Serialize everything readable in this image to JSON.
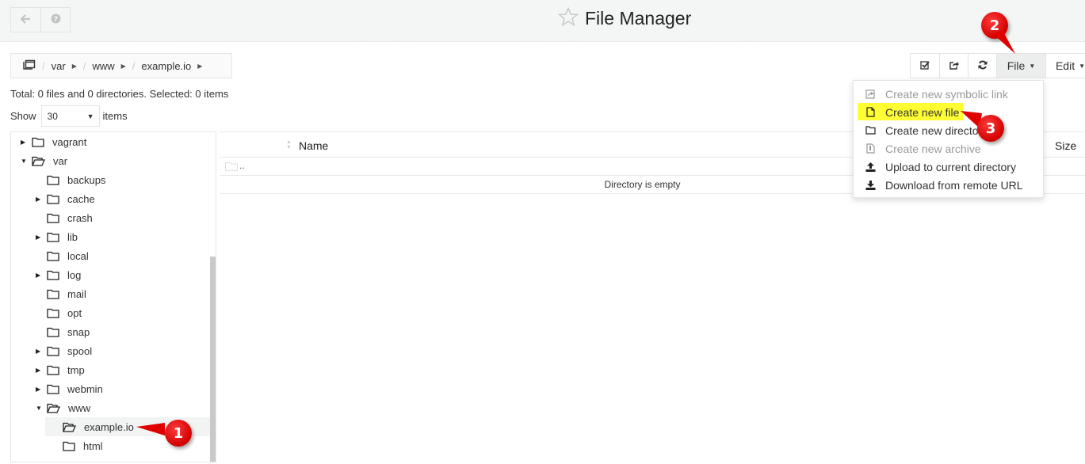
{
  "header": {
    "title": "File Manager",
    "back_icon": "arrow-left-icon",
    "help_icon": "question-circle-icon",
    "favorite_icon": "star-outline-icon"
  },
  "breadcrumb": {
    "root_icon": "folders-icon",
    "items": [
      "var",
      "www",
      "example.io"
    ]
  },
  "summary": "Total: 0 files and 0 directories. Selected: 0 items",
  "pagination": {
    "show_label": "Show",
    "selected": "30",
    "items_label": "items"
  },
  "toolbar": {
    "select_icon": "checkbox-icon",
    "share_icon": "share-icon",
    "refresh_icon": "refresh-icon",
    "file_label": "File",
    "edit_label": "Edit"
  },
  "file_menu": {
    "items": [
      {
        "label": "Create new symbolic link",
        "icon": "symlink-icon",
        "disabled": true
      },
      {
        "label": "Create new file",
        "icon": "file-icon",
        "disabled": false,
        "highlighted": true
      },
      {
        "label": "Create new directory",
        "icon": "folder-icon",
        "disabled": false
      },
      {
        "label": "Create new archive",
        "icon": "archive-icon",
        "disabled": true
      },
      {
        "label": "Upload to current directory",
        "icon": "upload-icon",
        "disabled": false
      },
      {
        "label": "Download from remote URL",
        "icon": "download-icon",
        "disabled": false
      }
    ],
    "highlight_color": "#ffff33"
  },
  "tree": {
    "items": [
      {
        "label": "vagrant",
        "level": 0,
        "toggle": "collapsed",
        "open": false
      },
      {
        "label": "var",
        "level": 0,
        "toggle": "expanded",
        "open": true
      },
      {
        "label": "backups",
        "level": 1,
        "toggle": "none",
        "open": false
      },
      {
        "label": "cache",
        "level": 1,
        "toggle": "collapsed",
        "open": false
      },
      {
        "label": "crash",
        "level": 1,
        "toggle": "none",
        "open": false
      },
      {
        "label": "lib",
        "level": 1,
        "toggle": "collapsed",
        "open": false
      },
      {
        "label": "local",
        "level": 1,
        "toggle": "none",
        "open": false
      },
      {
        "label": "log",
        "level": 1,
        "toggle": "collapsed",
        "open": false
      },
      {
        "label": "mail",
        "level": 1,
        "toggle": "none",
        "open": false
      },
      {
        "label": "opt",
        "level": 1,
        "toggle": "none",
        "open": false
      },
      {
        "label": "snap",
        "level": 1,
        "toggle": "none",
        "open": false
      },
      {
        "label": "spool",
        "level": 1,
        "toggle": "collapsed",
        "open": false
      },
      {
        "label": "tmp",
        "level": 1,
        "toggle": "collapsed",
        "open": false
      },
      {
        "label": "webmin",
        "level": 1,
        "toggle": "collapsed",
        "open": false
      },
      {
        "label": "www",
        "level": 1,
        "toggle": "expanded",
        "open": true
      },
      {
        "label": "example.io",
        "level": 2,
        "toggle": "none",
        "open": true,
        "selected": true
      },
      {
        "label": "html",
        "level": 2,
        "toggle": "none",
        "open": false
      }
    ]
  },
  "table": {
    "columns": [
      "Name",
      "Size"
    ],
    "parent_row": "..",
    "empty_message": "Directory is empty"
  },
  "callouts": [
    "1",
    "2",
    "3"
  ],
  "colors": {
    "callout": "#e00000",
    "header_bg": "#f4f5f5"
  }
}
